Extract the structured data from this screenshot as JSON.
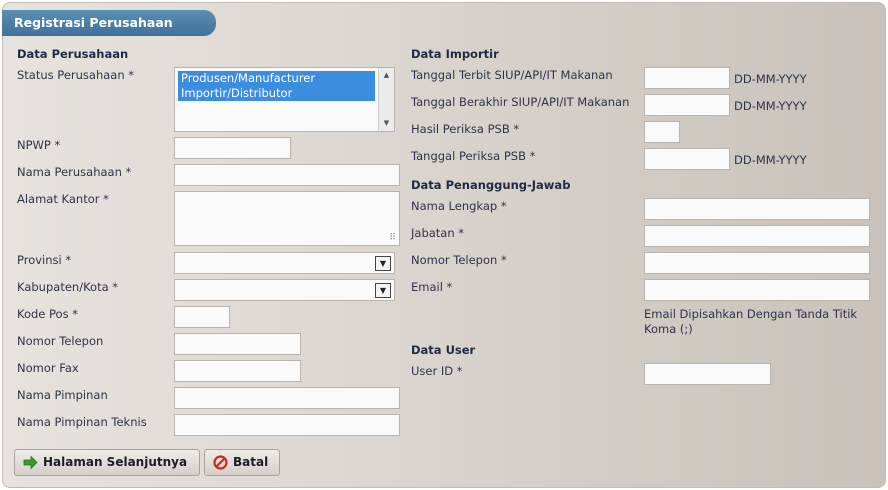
{
  "title": "Registrasi Perusahaan",
  "left": {
    "section": "Data Perusahaan",
    "status_label": "Status Perusahaan *",
    "status_options": [
      "Produsen/Manufacturer",
      "Importir/Distributor"
    ],
    "npwp_label": "NPWP *",
    "nama_label": "Nama Perusahaan *",
    "alamat_label": "Alamat Kantor *",
    "provinsi_label": "Provinsi *",
    "kabupaten_label": "Kabupaten/Kota *",
    "kodepos_label": "Kode Pos *",
    "telepon_label": "Nomor Telepon",
    "fax_label": "Nomor Fax",
    "pimpinan_label": "Nama Pimpinan",
    "pimpinan_teknis_label": "Nama Pimpinan Teknis"
  },
  "right": {
    "importir_section": "Data Importir",
    "terbit_label": "Tanggal Terbit SIUP/API/IT Makanan",
    "berakhir_label": "Tanggal Berakhir SIUP/API/IT Makanan",
    "hasil_label": "Hasil Periksa PSB *",
    "periksa_label": "Tanggal Periksa PSB *",
    "date_hint": "DD-MM-YYYY",
    "pj_section": "Data Penanggung-Jawab",
    "nama_lengkap_label": "Nama Lengkap *",
    "jabatan_label": "Jabatan *",
    "telepon_label": "Nomor Telepon *",
    "email_label": "Email *",
    "email_hint_line1": "Email Dipisahkan Dengan Tanda Titik",
    "email_hint_line2": "Koma (;)",
    "user_section": "Data User",
    "userid_label": "User ID *"
  },
  "buttons": {
    "next": "Halaman Selanjutnya",
    "cancel": "Batal"
  },
  "icons": {
    "next": "arrow-right-icon",
    "cancel": "prohibited-icon"
  },
  "colors": {
    "title_bar": "#4a7ea6",
    "selection": "#3b8de0",
    "next_icon": "#3a9a2e",
    "cancel_icon": "#d8261c"
  }
}
